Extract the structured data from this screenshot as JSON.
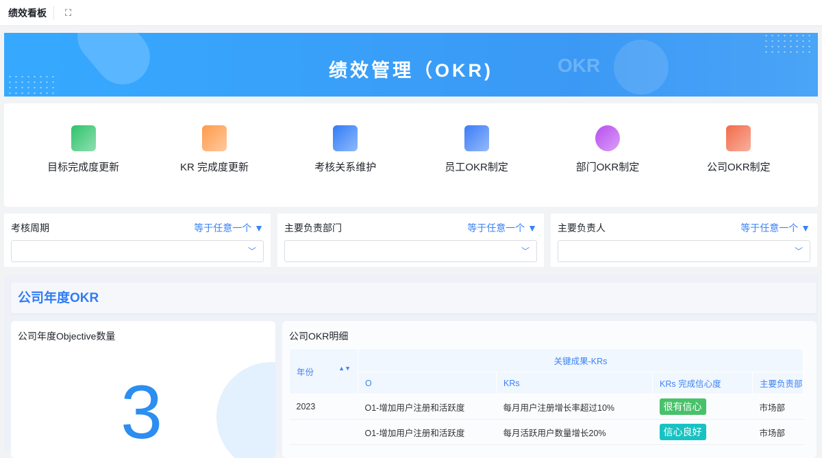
{
  "header": {
    "title": "绩效看板",
    "fullscreen_icon": "expand-icon"
  },
  "banner": {
    "title": "绩效管理（OKR)",
    "watermark": "OKR"
  },
  "quick": [
    {
      "label": "目标完成度更新",
      "color": "#2ec36b"
    },
    {
      "label": "KR 完成度更新",
      "color": "#ff9a4a"
    },
    {
      "label": "考核关系维护",
      "color": "#2f7cf6"
    },
    {
      "label": "员工OKR制定",
      "color": "#3b7cf6"
    },
    {
      "label": "部门OKR制定",
      "color": "#b84df0"
    },
    {
      "label": "公司OKR制定",
      "color": "#f26b4a"
    }
  ],
  "filters": [
    {
      "label": "考核周期",
      "op": "等于任意一个 ▼",
      "value": ""
    },
    {
      "label": "主要负责部门",
      "op": "等于任意一个 ▼",
      "value": ""
    },
    {
      "label": "主要负责人",
      "op": "等于任意一个 ▼",
      "value": ""
    }
  ],
  "section": {
    "title": "公司年度OKR"
  },
  "objective_count": {
    "title": "公司年度Objective数量",
    "value": "3"
  },
  "detail": {
    "title": "公司OKR明细",
    "group_header": "关键成果-KRs",
    "headers": {
      "year": "年份",
      "o": "O",
      "krs": "KRs",
      "confidence": "KRs 完成信心度",
      "dept": "主要负责部门"
    },
    "rows": [
      {
        "year": "2023",
        "o": "O1-增加用户注册和活跃度",
        "krs": "每月用户注册增长率超过10%",
        "confidence": "很有信心",
        "conf_color": "#49c16a",
        "dept": "市场部"
      },
      {
        "year": "",
        "o": "O1-增加用户注册和活跃度",
        "krs": "每月活跃用户数量增长20%",
        "confidence": "信心良好",
        "conf_color": "#19c2c2",
        "dept": "市场部"
      }
    ]
  }
}
